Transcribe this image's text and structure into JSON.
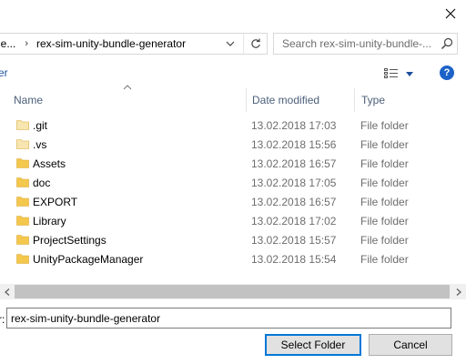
{
  "address": {
    "prev_crumb": "je...",
    "current_crumb": "rex-sim-unity-bundle-generator"
  },
  "search": {
    "placeholder": "Search rex-sim-unity-bundle-..."
  },
  "toolbar": {
    "left_label": "er",
    "help": "?"
  },
  "columns": {
    "name": "Name",
    "date": "Date modified",
    "type": "Type"
  },
  "items": [
    {
      "name": ".git",
      "date": "13.02.2018 17:03",
      "type": "File folder",
      "faded": true
    },
    {
      "name": ".vs",
      "date": "13.02.2018 15:56",
      "type": "File folder",
      "faded": true
    },
    {
      "name": "Assets",
      "date": "13.02.2018 16:57",
      "type": "File folder",
      "faded": false
    },
    {
      "name": "doc",
      "date": "13.02.2018 17:05",
      "type": "File folder",
      "faded": false
    },
    {
      "name": "EXPORT",
      "date": "13.02.2018 16:57",
      "type": "File folder",
      "faded": false
    },
    {
      "name": "Library",
      "date": "13.02.2018 17:02",
      "type": "File folder",
      "faded": false
    },
    {
      "name": "ProjectSettings",
      "date": "13.02.2018 15:57",
      "type": "File folder",
      "faded": false
    },
    {
      "name": "UnityPackageManager",
      "date": "13.02.2018 15:54",
      "type": "File folder",
      "faded": false
    }
  ],
  "folder": {
    "label": "r:",
    "value": "rex-sim-unity-bundle-generator"
  },
  "buttons": {
    "select": "Select Folder",
    "cancel": "Cancel"
  },
  "colors": {
    "folder": "#f4c74d",
    "folder_faded": "#f8e6b0",
    "accent": "#0078d7",
    "help": "#1c62c9"
  }
}
